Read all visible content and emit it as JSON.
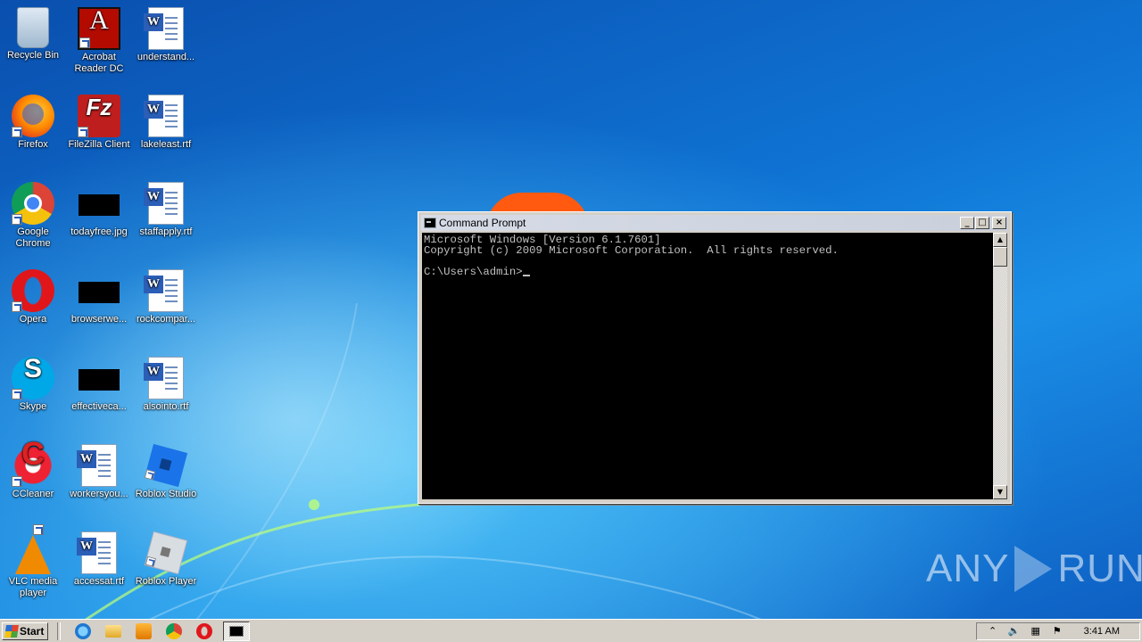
{
  "desktop": {
    "icons": [
      {
        "label": "Recycle Bin",
        "icon": "recycle-bin-icon"
      },
      {
        "label": "Acrobat Reader DC",
        "icon": "acrobat-icon"
      },
      {
        "label": "understand...",
        "icon": "word-document-icon"
      },
      {
        "label": "Firefox",
        "icon": "firefox-icon"
      },
      {
        "label": "FileZilla Client",
        "icon": "filezilla-icon"
      },
      {
        "label": "lakeleast.rtf",
        "icon": "word-document-icon"
      },
      {
        "label": "Google Chrome",
        "icon": "chrome-icon"
      },
      {
        "label": "todayfree.jpg",
        "icon": "image-thumbnail-icon"
      },
      {
        "label": "staffapply.rtf",
        "icon": "word-document-icon"
      },
      {
        "label": "Opera",
        "icon": "opera-icon"
      },
      {
        "label": "browserwe...",
        "icon": "image-thumbnail-icon"
      },
      {
        "label": "rockcompar...",
        "icon": "word-document-icon"
      },
      {
        "label": "Skype",
        "icon": "skype-icon"
      },
      {
        "label": "effectiveca...",
        "icon": "image-thumbnail-icon"
      },
      {
        "label": "alsointo.rtf",
        "icon": "word-document-icon"
      },
      {
        "label": "CCleaner",
        "icon": "ccleaner-icon"
      },
      {
        "label": "workersyou...",
        "icon": "word-document-icon"
      },
      {
        "label": "Roblox Studio",
        "icon": "roblox-studio-icon"
      },
      {
        "label": "VLC media player",
        "icon": "vlc-icon"
      },
      {
        "label": "accessat.rtf",
        "icon": "word-document-icon"
      },
      {
        "label": "Roblox Player",
        "icon": "roblox-player-icon"
      }
    ]
  },
  "cmd": {
    "title": "Command Prompt",
    "lines": [
      "Microsoft Windows [Version 6.1.7601]",
      "Copyright (c) 2009 Microsoft Corporation.  All rights reserved.",
      "",
      "C:\\Users\\admin>"
    ],
    "buttons": {
      "minimize": "_",
      "maximize": "□",
      "close": "×"
    },
    "scroll": {
      "up": "▲",
      "down": "▼"
    }
  },
  "watermark": {
    "left": "ANY",
    "right": "RUN"
  },
  "taskbar": {
    "start_label": "Start",
    "clock": "3:41 AM",
    "tray": {
      "expand": "⌃",
      "volume": "🔈",
      "network": "▦",
      "flag": "⚑"
    }
  }
}
